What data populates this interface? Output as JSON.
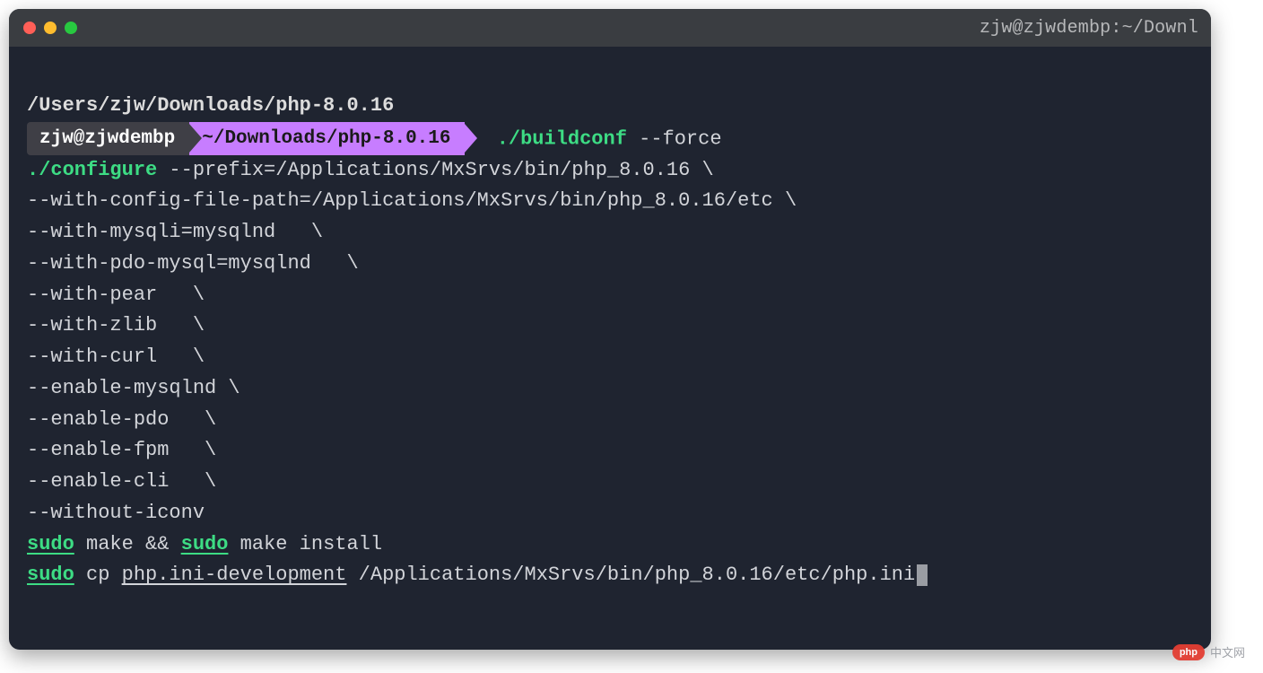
{
  "window": {
    "title": "zjw@zjwdembp:~/Downl"
  },
  "prompt": {
    "user_host": "zjw@zjwdembp",
    "cwd_short": "~/Downloads/php-8.0.16",
    "cwd_full": "/Users/zjw/Downloads/php-8.0.16"
  },
  "cmd": {
    "buildconf": "./buildconf",
    "buildconf_arg": " --force",
    "configure": "./configure",
    "configure_args": [
      " --prefix=/Applications/MxSrvs/bin/php_8.0.16 \\",
      "--with-config-file-path=/Applications/MxSrvs/bin/php_8.0.16/etc \\",
      "--with-mysqli=mysqlnd   \\",
      "--with-pdo-mysql=mysqlnd   \\",
      "--with-pear   \\",
      "--with-zlib   \\",
      "--with-curl   \\",
      "--enable-mysqlnd \\",
      "--enable-pdo   \\",
      "--enable-fpm   \\",
      "--enable-cli   \\",
      "--without-iconv"
    ],
    "sudo": "sudo",
    "make": " make && ",
    "make_tail": " make install",
    "cp": " cp ",
    "cp_src": "php.ini-development",
    "cp_dst": " /Applications/MxSrvs/bin/php_8.0.16/etc/php.ini"
  },
  "watermark": {
    "pill": "php",
    "text": "中文网"
  }
}
